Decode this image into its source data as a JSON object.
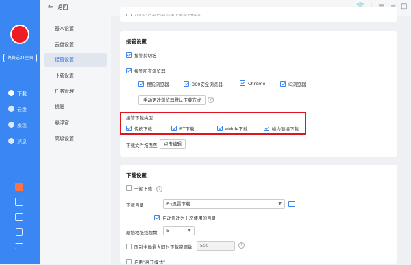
{
  "sidebar": {
    "free_space": "免费送2T空间",
    "nav": [
      {
        "label": "下载",
        "icon": "download-icon"
      },
      {
        "label": "云盘",
        "icon": "cloud-icon"
      },
      {
        "label": "发现",
        "icon": "compass-icon"
      },
      {
        "label": "消息",
        "icon": "message-icon"
      }
    ],
    "bottom_icons": [
      "gift-icon",
      "image-icon",
      "shirt-icon",
      "phone-icon",
      "menu-icon"
    ]
  },
  "topbar": {
    "back_label": "返回"
  },
  "settings_nav": [
    "基本设置",
    "云盘设置",
    "接管设置",
    "下载设置",
    "任务管理",
    "提醒",
    "悬浮窗",
    "高级设置"
  ],
  "settings_nav_active": "接管设置",
  "takeover": {
    "top_partial": "开机时自动启动迅雷下载支持模式",
    "title": "接管设置",
    "clipboard": "接管剪切板",
    "all_browsers": "接管所有浏览器",
    "browsers": [
      "搜狗浏览器",
      "360安全浏览器",
      "Chrome",
      "IE浏览器"
    ],
    "manual_button": "手动更改浏览器默认下载方式",
    "types_title": "接管下载类型",
    "types": [
      "传统下载",
      "BT下载",
      "eMule下载",
      "磁力链接下载"
    ],
    "drag_label": "下载文件拖曳至",
    "edit_button": "点击编辑"
  },
  "download": {
    "title": "下载设置",
    "one_click": "一键下载",
    "dir_label": "下载目录",
    "dir_value": "E:\\迅雷下载",
    "auto_dir": "自动修改为上次使用的目录",
    "threads_label": "原始地址线程数",
    "threads_value": "5",
    "limit_label": "限制全局最大同时下载资源数",
    "limit_value": "500",
    "enable_partial": "启用\"高开模式\""
  },
  "colors": {
    "accent": "#3a86f2",
    "highlight": "#e0141e",
    "avatar": "#ee1c25"
  }
}
